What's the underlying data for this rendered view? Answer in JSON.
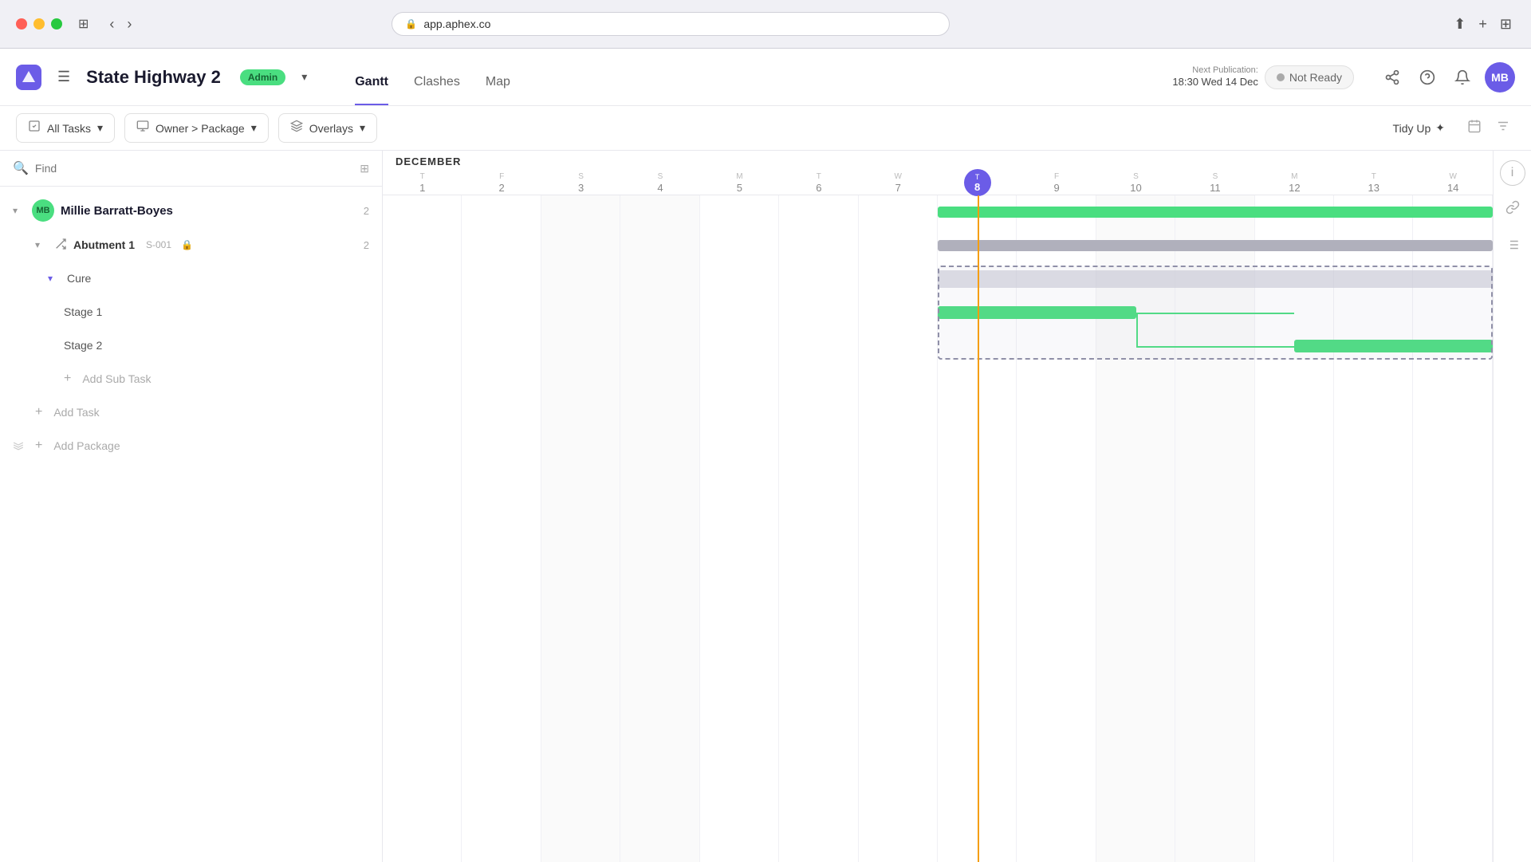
{
  "browser": {
    "url": "app.aphex.co",
    "reload_icon": "↻"
  },
  "header": {
    "project_title": "State Highway 2",
    "admin_badge": "Admin",
    "nav_tabs": [
      {
        "id": "gantt",
        "label": "Gantt",
        "active": true
      },
      {
        "id": "clashes",
        "label": "Clashes",
        "active": false
      },
      {
        "id": "map",
        "label": "Map",
        "active": false
      }
    ],
    "publication": {
      "label": "Next Publication:",
      "date": "18:30 Wed 14 Dec",
      "status": "Not Ready"
    },
    "user_initials": "MB"
  },
  "toolbar": {
    "all_tasks_label": "All Tasks",
    "owner_package_label": "Owner > Package",
    "overlays_label": "Overlays",
    "tidy_up_label": "Tidy Up"
  },
  "left_panel": {
    "search_placeholder": "Find",
    "tree": {
      "owner": {
        "initials": "MB",
        "name": "Millie Barratt-Boyes",
        "count": "2"
      },
      "package": {
        "name": "Abutment 1",
        "code": "S-001",
        "count": "2"
      },
      "cure": {
        "name": "Cure"
      },
      "stages": [
        {
          "name": "Stage 1"
        },
        {
          "name": "Stage 2"
        }
      ],
      "add_subtask": "Add Sub Task",
      "add_task": "Add Task",
      "add_package": "Add Package"
    }
  },
  "gantt": {
    "month": "DECEMBER",
    "days": [
      {
        "letter": "T",
        "num": "1"
      },
      {
        "letter": "F",
        "num": "2"
      },
      {
        "letter": "S",
        "num": "3",
        "weekend": true
      },
      {
        "letter": "S",
        "num": "4",
        "weekend": true
      },
      {
        "letter": "M",
        "num": "5"
      },
      {
        "letter": "T",
        "num": "6"
      },
      {
        "letter": "W",
        "num": "7"
      },
      {
        "letter": "T",
        "num": "8",
        "today": true
      },
      {
        "letter": "F",
        "num": "9"
      },
      {
        "letter": "S",
        "num": "10",
        "weekend": true
      },
      {
        "letter": "S",
        "num": "11",
        "weekend": true
      },
      {
        "letter": "M",
        "num": "12"
      },
      {
        "letter": "T",
        "num": "13"
      },
      {
        "letter": "W",
        "num": "14"
      }
    ],
    "today_col_index": 7
  }
}
